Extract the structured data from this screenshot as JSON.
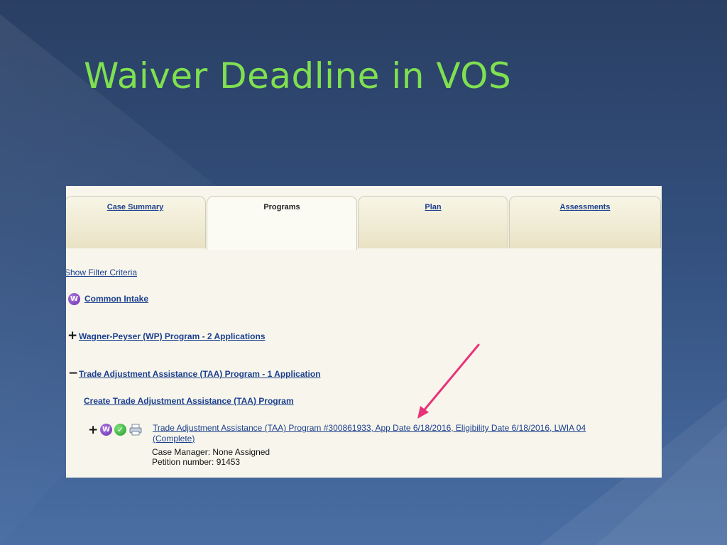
{
  "slide": {
    "title": "Waiver Deadline in VOS",
    "title_color": "#7fe050",
    "accent_arrow_color": "#e8337a"
  },
  "tabs": [
    {
      "label": "Case Summary",
      "active": false
    },
    {
      "label": "Programs",
      "active": true
    },
    {
      "label": "Plan",
      "active": false
    },
    {
      "label": "Assessments",
      "active": false
    }
  ],
  "content": {
    "show_filter": "Show Filter Criteria",
    "common_intake": {
      "badge": "W",
      "label": "Common Intake"
    },
    "wagner": {
      "toggle": "+",
      "label": "Wagner-Peyser (WP) Program - 2 Applications"
    },
    "taa": {
      "toggle": "−",
      "label": "Trade Adjustment Assistance (TAA) Program - 1 Application"
    },
    "create_taa": "Create Trade Adjustment Assistance (TAA) Program",
    "taa_record": {
      "toggle": "+",
      "badge": "W",
      "check": "✓",
      "line1": "Trade Adjustment Assistance (TAA) Program #300861933, App Date 6/18/2016, Eligibility Date 6/18/2016, LWIA 04",
      "line2": "(Complete)",
      "case_manager": "Case Manager: None Assigned",
      "petition": "Petition number: 91453"
    }
  }
}
